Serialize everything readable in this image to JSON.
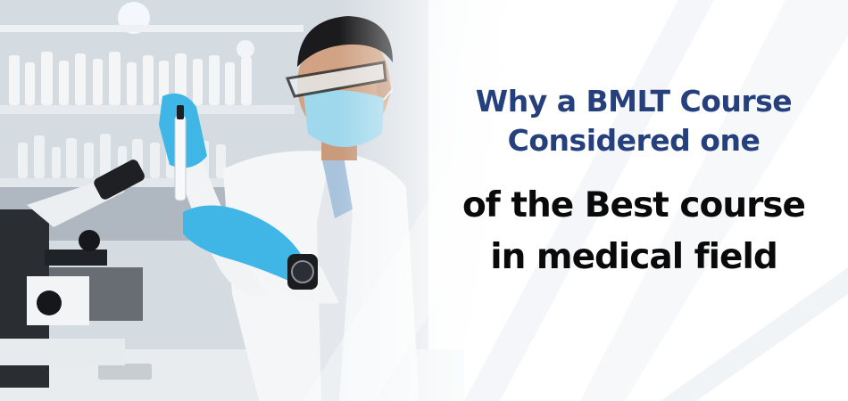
{
  "banner": {
    "headline": {
      "line1": "Why a BMLT Course",
      "line2": "Considered one",
      "line3": "of the Best course",
      "line4": "in medical field"
    },
    "colors": {
      "headline_blue": "#25407c",
      "headline_black": "#0a0a0a",
      "glove": "#3fb6e6",
      "mask": "#9fd8ec",
      "coat": "#f4f6f8"
    },
    "photo": {
      "subject": "lab-technician-icon",
      "props": [
        "pipette-icon",
        "microscope-icon",
        "wristwatch-icon",
        "shelf-bottles-icon"
      ]
    }
  }
}
